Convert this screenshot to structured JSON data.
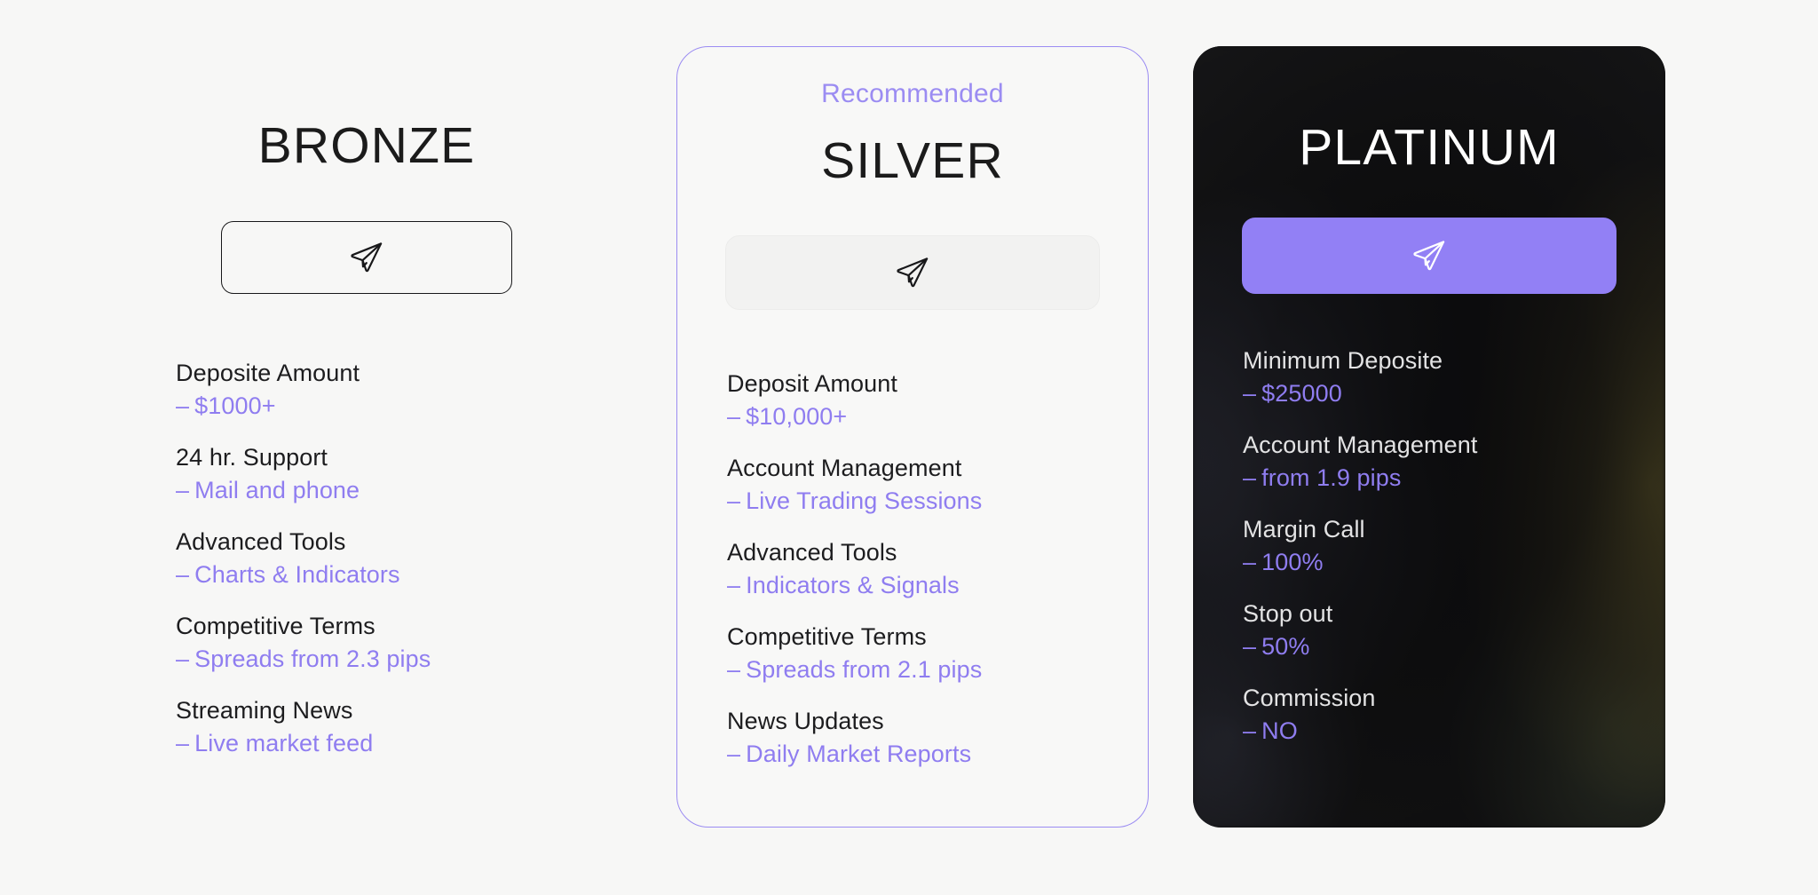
{
  "theme": {
    "page_background": "#f7f7f6",
    "accent_purple": "#8f7df0",
    "badge_purple": "#9b8cf2",
    "platinum_button": "#9280f5",
    "dark_card": "#121212"
  },
  "plans": {
    "bronze": {
      "title": "BRONZE",
      "cta_icon": "paper-plane-icon",
      "features": [
        {
          "label": "Deposite Amount",
          "dash": "–",
          "value": "$1000+"
        },
        {
          "label": "24 hr. Support",
          "dash": "–",
          "value": "Mail and phone"
        },
        {
          "label": "Advanced Tools",
          "dash": "–",
          "value": "Charts & Indicators"
        },
        {
          "label": "Competitive Terms",
          "dash": "–",
          "value": "Spreads from 2.3 pips"
        },
        {
          "label": "Streaming News",
          "dash": "–",
          "value": "Live market feed"
        }
      ]
    },
    "silver": {
      "badge": "Recommended",
      "title": "SILVER",
      "cta_icon": "paper-plane-icon",
      "features": [
        {
          "label": "Deposit Amount",
          "dash": "–",
          "value": "$10,000+"
        },
        {
          "label": "Account Management",
          "dash": "–",
          "value": "Live Trading Sessions"
        },
        {
          "label": "Advanced Tools",
          "dash": "–",
          "value": "Indicators & Signals"
        },
        {
          "label": "Competitive Terms",
          "dash": "–",
          "value": "Spreads from 2.1 pips"
        },
        {
          "label": "News Updates",
          "dash": "–",
          "value": "Daily Market Reports"
        }
      ]
    },
    "platinum": {
      "title": "PLATINUM",
      "cta_icon": "paper-plane-icon",
      "features": [
        {
          "label": "Minimum Deposite",
          "dash": "–",
          "value": "$25000"
        },
        {
          "label": "Account Management",
          "dash": "–",
          "value": "from 1.9 pips"
        },
        {
          "label": "Margin Call",
          "dash": "–",
          "value": "100%"
        },
        {
          "label": "Stop out",
          "dash": "–",
          "value": "50%"
        },
        {
          "label": "Commission",
          "dash": "–",
          "value": "NO"
        }
      ]
    }
  }
}
